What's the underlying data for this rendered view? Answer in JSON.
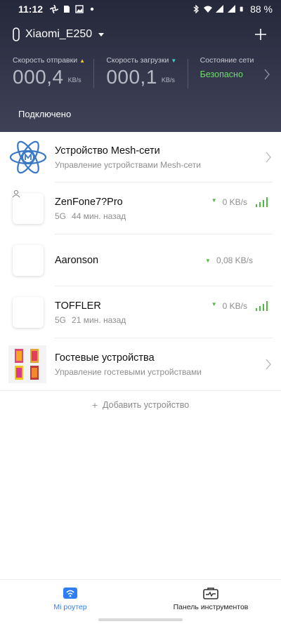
{
  "status_bar": {
    "time": "11:12",
    "battery": "88 %"
  },
  "header": {
    "router_name": "Xiaomi_E250",
    "stats": {
      "upload_label": "Скорость отправки",
      "upload_value": "000,4",
      "upload_unit": "KB/s",
      "download_label": "Скорость загрузки",
      "download_value": "000,1",
      "download_unit": "KB/s",
      "network_label": "Состояние сети",
      "network_value": "Безопасно"
    },
    "connected_label": "Подключено"
  },
  "devices": {
    "mesh": {
      "title": "Устройство Mesh-сети",
      "subtitle": "Управление устройствами Mesh-сети"
    },
    "zenfone": {
      "title": "ZenFone7?Pro",
      "band": "5G",
      "time": "44 мин. назад",
      "speed": "0 KB/s"
    },
    "aaronson": {
      "title": "Aaronson",
      "speed": "0,08 KB/s"
    },
    "toffler": {
      "title": "TOFFLER",
      "band": "5G",
      "time": "21 мин. назад",
      "speed": "0 KB/s"
    },
    "guest": {
      "title": "Гостевые устройства",
      "subtitle": "Управление гостевыми устройствами"
    }
  },
  "add_device": "Добавить устройство",
  "bottom_nav": {
    "router": "Mi роутер",
    "toolbox": "Панель инструментов"
  },
  "colors": {
    "accent": "#2f7ef5",
    "secure": "#6fdc6a",
    "signal": "#4cbb3f"
  }
}
